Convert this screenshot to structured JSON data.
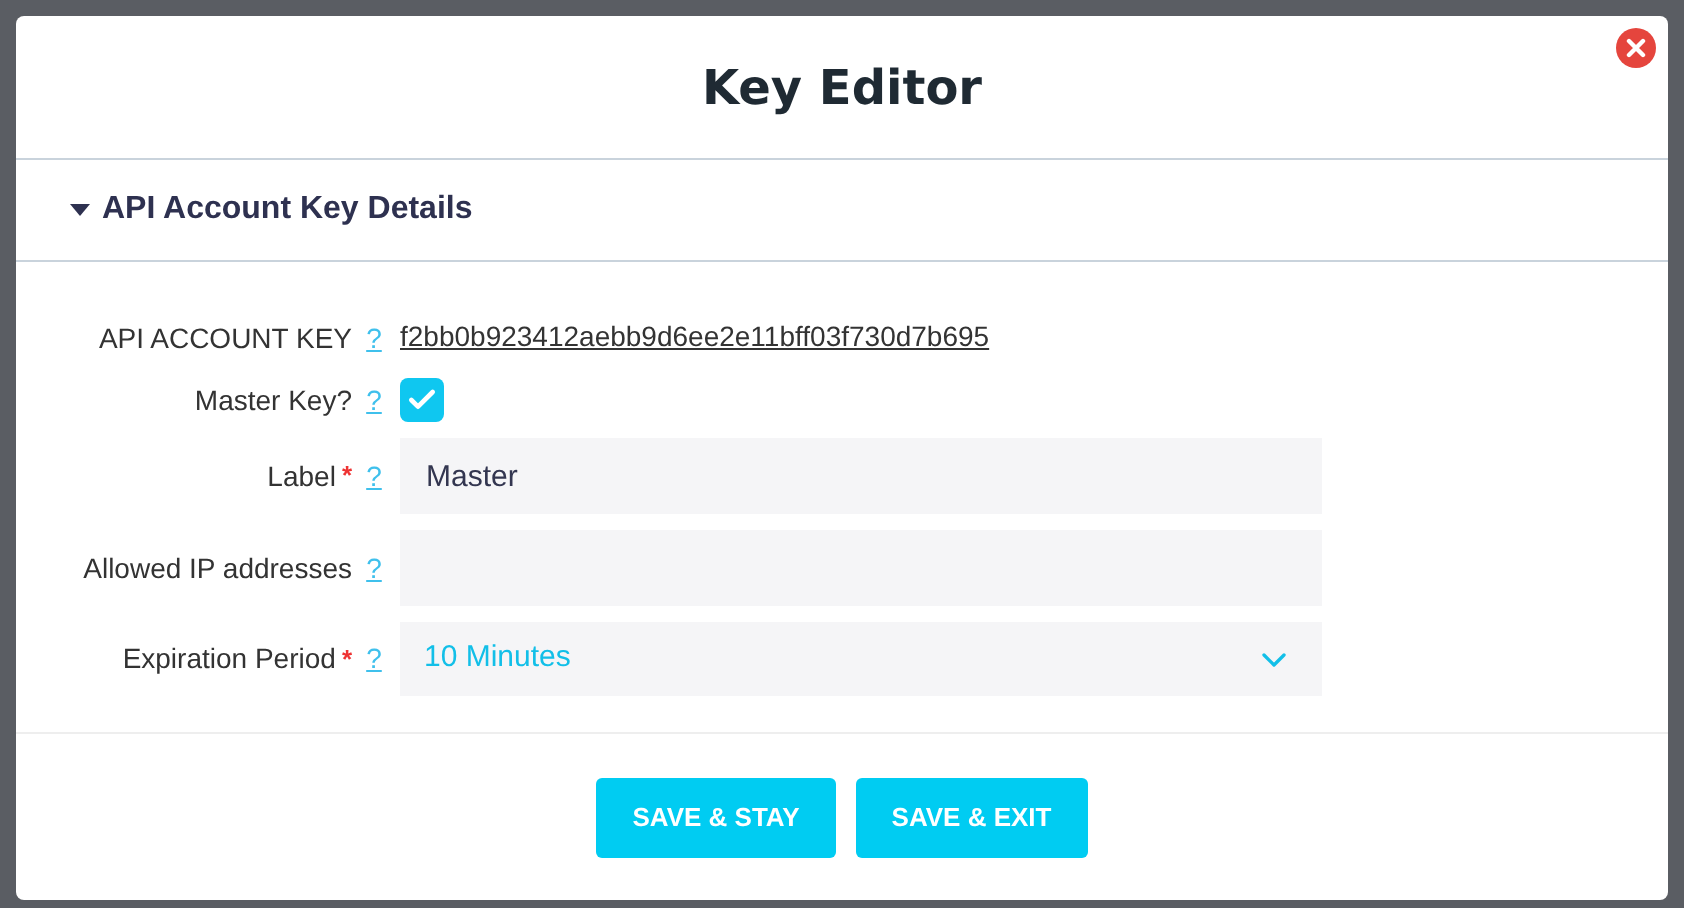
{
  "dialog": {
    "title": "Key Editor"
  },
  "section": {
    "title": "API Account Key Details",
    "expanded": true
  },
  "fields": [
    {
      "kind": "link",
      "label": "API ACCOUNT KEY",
      "help": "?",
      "value": "f2bb0b923412aebb9d6ee2e11bff03f730d7b695"
    },
    {
      "kind": "checkbox",
      "label": "Master Key?",
      "help": "?",
      "checked": true
    },
    {
      "kind": "text",
      "label": "Label",
      "required_mark": "*",
      "help": "?",
      "value": "Master"
    },
    {
      "kind": "text",
      "label": "Allowed IP addresses",
      "help": "?"
    },
    {
      "kind": "select",
      "label": "Expiration Period",
      "required_mark": "*",
      "help": "?",
      "value": "10 Minutes"
    }
  ],
  "buttons": [
    "SAVE & STAY",
    "SAVE & EXIT"
  ]
}
